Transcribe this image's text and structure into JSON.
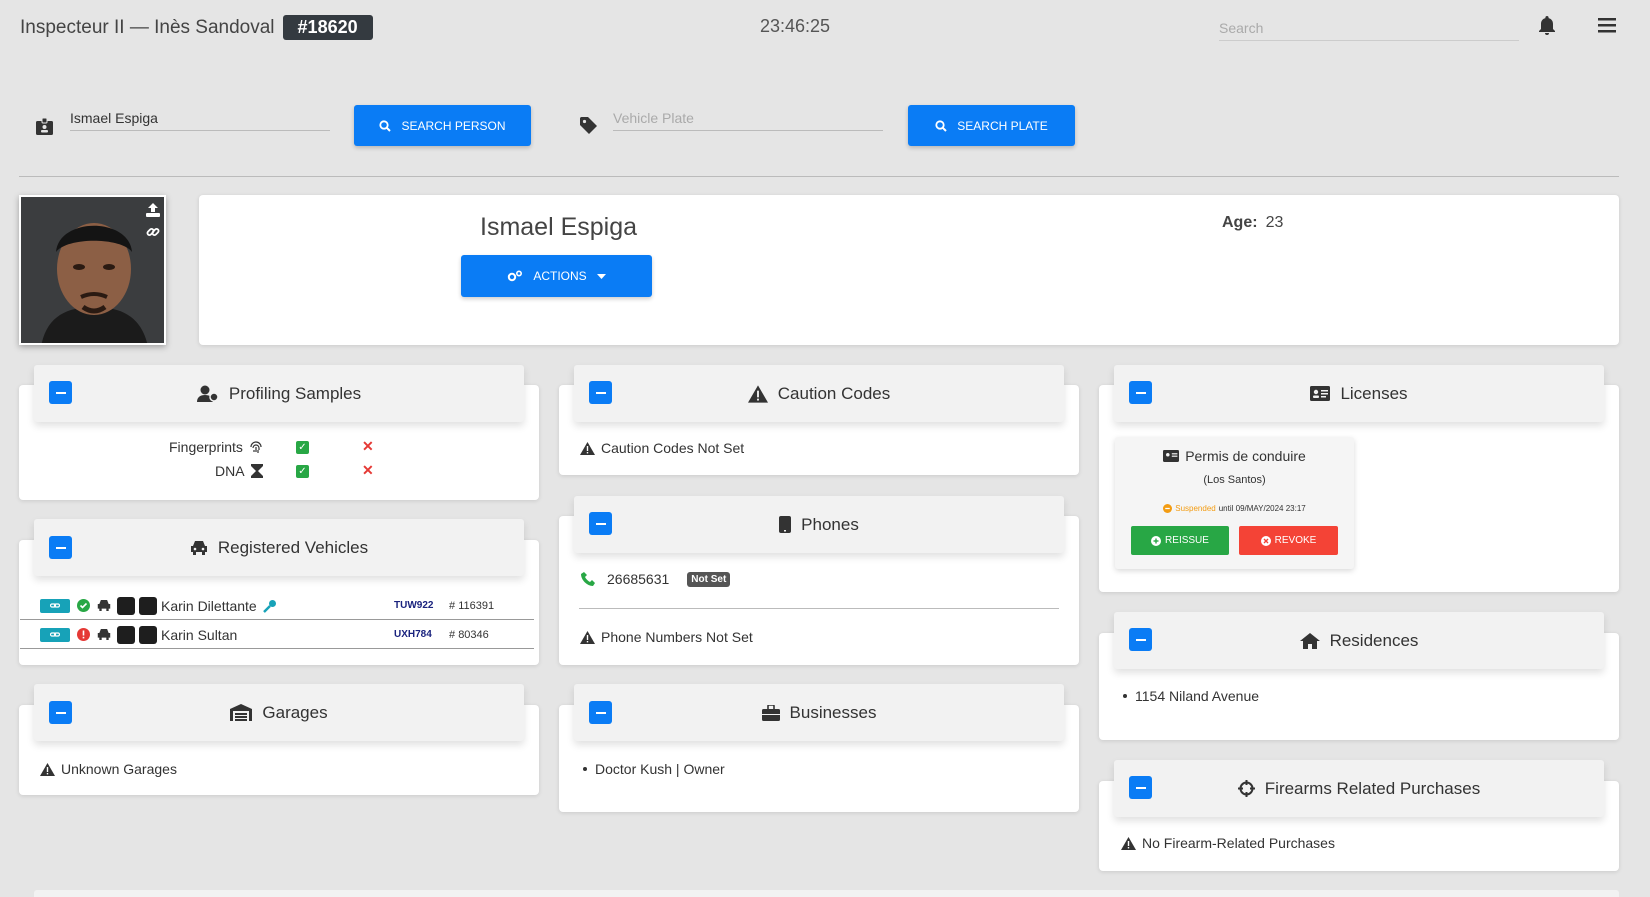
{
  "header": {
    "officer": "Inspecteur II — Inès Sandoval",
    "badge": "#18620",
    "clock": "23:46:25",
    "search_placeholder": "Search"
  },
  "search": {
    "person_value": "Ismael Espiga",
    "person_button": "SEARCH PERSON",
    "plate_placeholder": "Vehicle Plate",
    "plate_button": "SEARCH PLATE"
  },
  "profile": {
    "name": "Ismael Espiga",
    "actions_label": "ACTIONS",
    "age_label": "Age:",
    "age_value": "23"
  },
  "profiling": {
    "title": "Profiling Samples",
    "rows": [
      {
        "label": "Fingerprints"
      },
      {
        "label": "DNA"
      }
    ]
  },
  "vehicles": {
    "title": "Registered Vehicles",
    "rows": [
      {
        "name": "Karin Dilettante",
        "plate": "TUW922",
        "id": "116391",
        "status": "ok",
        "keys": true
      },
      {
        "name": "Karin Sultan",
        "plate": "UXH784",
        "id": "80346",
        "status": "alert",
        "keys": false
      }
    ]
  },
  "garages": {
    "title": "Garages",
    "note": "Unknown Garages"
  },
  "caution": {
    "title": "Caution Codes",
    "note": "Caution Codes Not Set"
  },
  "phones": {
    "title": "Phones",
    "number": "26685631",
    "number_tag": "Not Set",
    "note": "Phone Numbers Not Set"
  },
  "businesses": {
    "title": "Businesses",
    "items": [
      "Doctor Kush | Owner"
    ]
  },
  "licenses": {
    "title": "Licenses",
    "license_name": "Permis de conduire",
    "license_region": "(Los Santos)",
    "status": "Suspended",
    "status_until": "until 09/MAY/2024 23:17",
    "reissue": "REISSUE",
    "revoke": "REVOKE"
  },
  "residences": {
    "title": "Residences",
    "items": [
      "1154 Niland Avenue"
    ]
  },
  "firearms": {
    "title": "Firearms Related Purchases",
    "note": "No Firearm-Related Purchases"
  },
  "colors": {
    "primary": "#0a7cf5",
    "success": "#28a745",
    "danger": "#e53935",
    "warning": "#f39c12",
    "info": "#17a2b8"
  }
}
